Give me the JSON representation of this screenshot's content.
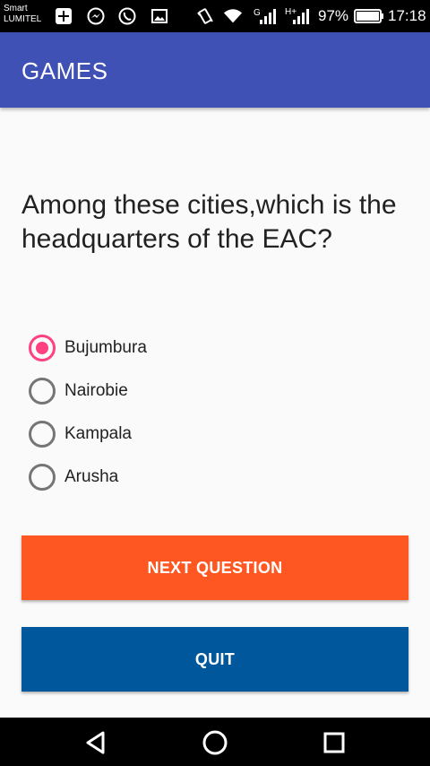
{
  "status_bar": {
    "carrier_line1": "Smart",
    "carrier_line2": "LUMITEL",
    "network_type_1": "G",
    "network_type_2": "H+",
    "battery": "97%",
    "time": "17:18"
  },
  "app_bar": {
    "title": "GAMES"
  },
  "question": {
    "text": "Among these cities,which is the headquarters of the EAC?"
  },
  "options": [
    {
      "label": "Bujumbura",
      "selected": true
    },
    {
      "label": "Nairobie",
      "selected": false
    },
    {
      "label": "Kampala",
      "selected": false
    },
    {
      "label": "Arusha",
      "selected": false
    }
  ],
  "buttons": {
    "next_label": "NEXT QUESTION",
    "quit_label": "QUIT"
  },
  "colors": {
    "app_bar": "#3f51b5",
    "accent": "#ff4081",
    "next_button": "#ff5722",
    "quit_button": "#01579b"
  }
}
